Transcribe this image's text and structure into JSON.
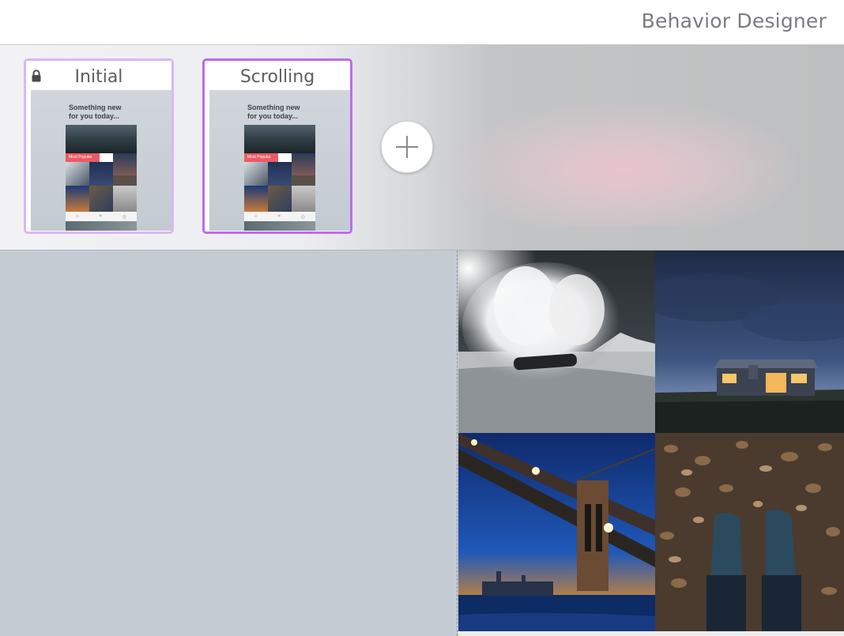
{
  "app": {
    "title": "Behavior Designer"
  },
  "states": [
    {
      "label": "Initial",
      "locked": true,
      "selected": false,
      "border_color": "#ddb6f4"
    },
    {
      "label": "Scrolling",
      "locked": false,
      "selected": true,
      "border_color": "#bb6cec"
    }
  ],
  "thumbnail": {
    "headline": "Something new\nfor you today...",
    "badge": "Most Popular",
    "tabs": [
      "home-icon",
      "grid-icon",
      "profile-icon"
    ],
    "badge_color": "#ec5a63"
  },
  "add_state": {
    "icon": "plus-icon"
  },
  "canvas": {
    "photos": [
      {
        "name": "snowboard-photo",
        "subject": "snowboarder spraying snow"
      },
      {
        "name": "cabin-photo",
        "subject": "lit cabin at dusk"
      },
      {
        "name": "bridge-photo",
        "subject": "bridge at night over river"
      },
      {
        "name": "boots-photo",
        "subject": "boots on autumn leaves"
      }
    ],
    "background_color": "#c4cbd3"
  }
}
